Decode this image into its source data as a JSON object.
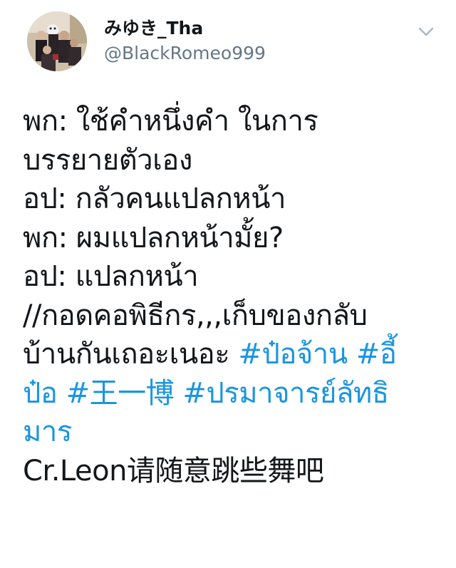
{
  "author": {
    "display_name": "みゆき_Tha",
    "handle": "@BlackRomeo999",
    "avatar_icon": "group-photo-avatar"
  },
  "menu": {
    "icon": "chevron-down-icon"
  },
  "tweet": {
    "lines": [
      "พก: ใช้คำหนึ่งคำ ในการ",
      "บรรยายตัวเอง",
      "อป: กลัวคนแปลกหน้า",
      "พก: ผมแปลกหน้ามั้ย?",
      "อป: แปลกหน้า",
      "//กอดคอพิธีกร,,,เก็บของกลับ",
      "บ้านกันเถอะเนอะ "
    ],
    "hashtags": [
      "#ป๋อจ้าน",
      "#อี้",
      "ป๋อ",
      "#王一博",
      "#ปรมาจารย์ลัทธิ",
      "มาร"
    ],
    "credit": "Cr.Leon请随意跳些舞吧"
  },
  "colors": {
    "text": "#14171a",
    "secondary": "#657786",
    "link": "#1b95e0"
  }
}
